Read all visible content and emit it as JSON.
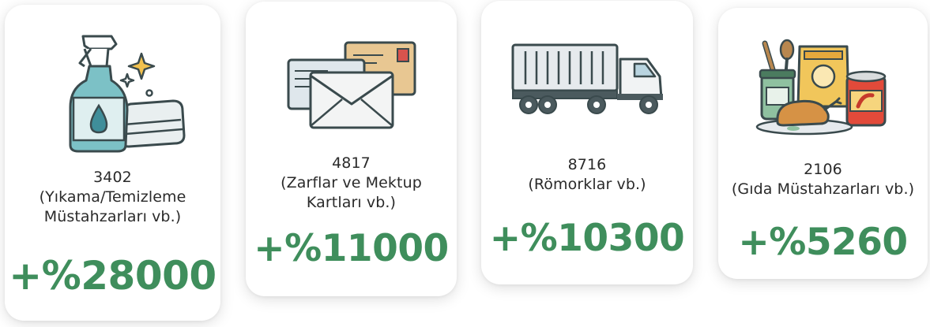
{
  "cards": [
    {
      "icon": "spray-bottle-and-towel-icon",
      "code": "3402",
      "description_lines": [
        "(Yıkama/Temizleme",
        "Müstahzarları vb.)"
      ],
      "change": "+%28000"
    },
    {
      "icon": "envelopes-icon",
      "code": "4817",
      "description_lines": [
        "(Zarflar ve Mektup",
        "Kartları vb.)"
      ],
      "change": "+%11000"
    },
    {
      "icon": "truck-trailer-icon",
      "code": "8716",
      "description_lines": [
        "(Römorklar vb.)"
      ],
      "change": "+%10300"
    },
    {
      "icon": "food-products-icon",
      "code": "2106",
      "description_lines": [
        "(Gıda Müstahzarları vb.)"
      ],
      "change": "+%5260"
    }
  ],
  "colors": {
    "accent_green": "#3f8e5c",
    "text_dark": "#2a2a2a",
    "card_background": "#ffffff"
  }
}
